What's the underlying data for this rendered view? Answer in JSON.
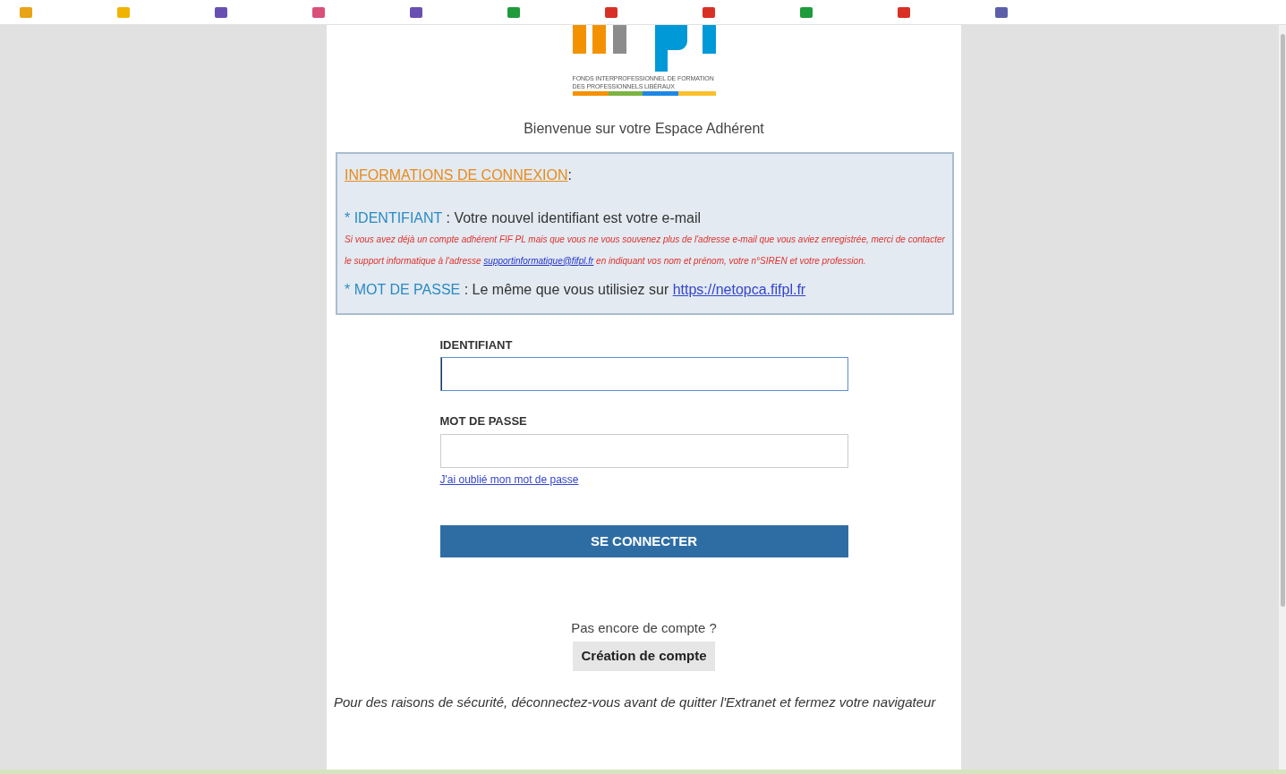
{
  "bookmarks": [
    {
      "color": "#e8a317"
    },
    {
      "color": "#f0b400"
    },
    {
      "color": "#6a4fb3"
    },
    {
      "color": "#d9507a"
    },
    {
      "color": "#6a4fb3"
    },
    {
      "color": "#1e9b3c"
    },
    {
      "color": "#d93025"
    },
    {
      "color": "#d93025"
    },
    {
      "color": "#1e9b3c"
    },
    {
      "color": "#d93025"
    },
    {
      "color": "#5b5fa8"
    }
  ],
  "logo": {
    "caption_lines": [
      "FONDS INTERPROFESSIONNEL DE FORMATION",
      "DES PROFESSIONNELS LIBÉRAUX"
    ]
  },
  "welcome": "Bienvenue sur votre Espace Adhérent",
  "info": {
    "title": "INFORMATIONS DE CONNEXION",
    "title_suffix": ":",
    "identifiant": {
      "label": "* IDENTIFIANT",
      "text": " : Votre nouvel identifiant est votre e-mail"
    },
    "note_before": "Si vous avez déjà un compte adhérent FIF PL mais que vous ne vous souvenez plus de l'adresse e-mail que vous aviez enregistrée, merci de contacter le support informatique à l'adresse ",
    "note_link": "supportinformatique@fifpl.fr",
    "note_after": " en indiquant vos nom et prénom, votre n°SIREN et votre profession.",
    "password": {
      "label": "* MOT DE PASSE",
      "text": " : Le même que vous utilisiez sur ",
      "link": "https://netopca.fifpl.fr"
    }
  },
  "form": {
    "fields": [
      {
        "label": "IDENTIFIANT",
        "focused": true
      },
      {
        "label": "MOT DE PASSE",
        "focused": false
      }
    ],
    "forgot_link": "J'ai oublié mon mot de passe",
    "submit": "SE CONNECTER"
  },
  "signup": {
    "question": "Pas encore de compte ?",
    "button": "Création de compte"
  },
  "security_note": "Pour des raisons de sécurité, déconnectez-vous avant de quitter l'Extranet et fermez votre navigateur"
}
